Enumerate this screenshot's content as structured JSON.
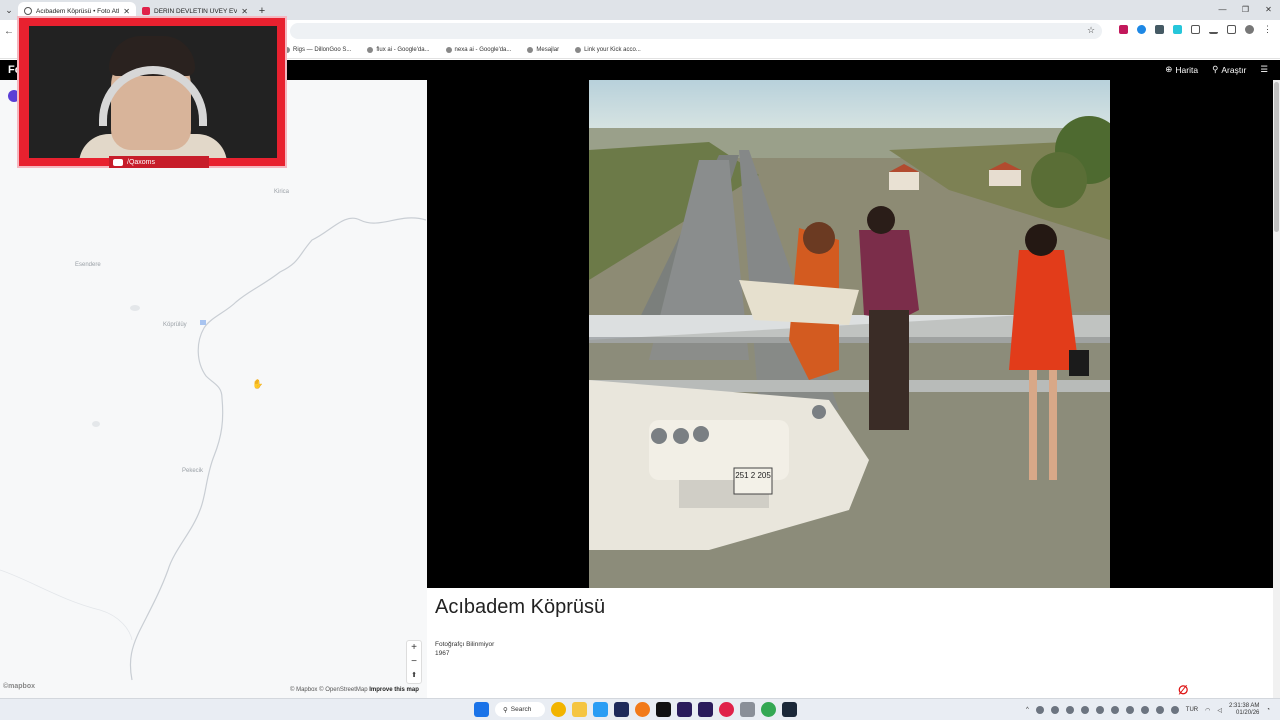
{
  "browser": {
    "tabs": [
      {
        "title": "Acıbadem Köprüsü • Foto Atlas",
        "active": true,
        "icon": "globe-icon"
      },
      {
        "title": "DERİN DEVLETİN ÜVEY EVLADI",
        "active": false,
        "icon": "youtube-icon"
      }
    ],
    "bookmarks": [
      {
        "label": "Rigs — DillonGoo S..."
      },
      {
        "label": "flux ai - Google'da..."
      },
      {
        "label": "nexa ai - Google'da..."
      },
      {
        "label": "Mesajlar"
      },
      {
        "label": "Link your Kick acco..."
      }
    ]
  },
  "site": {
    "logo": "Fo",
    "nav": {
      "map_label": "Harita",
      "explore_label": "Araştır"
    }
  },
  "map": {
    "places": [
      {
        "name": "Kirica",
        "key": "kirica"
      },
      {
        "name": "Esendere",
        "key": "esendere"
      },
      {
        "name": "Köprülüy",
        "key": "koprulu"
      },
      {
        "name": "Pekecik",
        "key": "pekecik"
      }
    ],
    "zoom_in": "+",
    "zoom_out": "−",
    "compass": "⬆",
    "logo": "©mapbox",
    "attribution_prefix": "© Mapbox © OpenStreetMap",
    "attribution_link": "Improve this map"
  },
  "webcam": {
    "channel": "/Qaxoms"
  },
  "photo": {
    "title": "Acıbadem Köprüsü",
    "photographer": "Fotoğrafçı Bilinmiyor",
    "year": "1967",
    "plate": "251 2 205"
  },
  "taskbar": {
    "search_label": "Search",
    "language": "TUR",
    "time": "2:31:38 AM",
    "date": "01/20/26"
  }
}
